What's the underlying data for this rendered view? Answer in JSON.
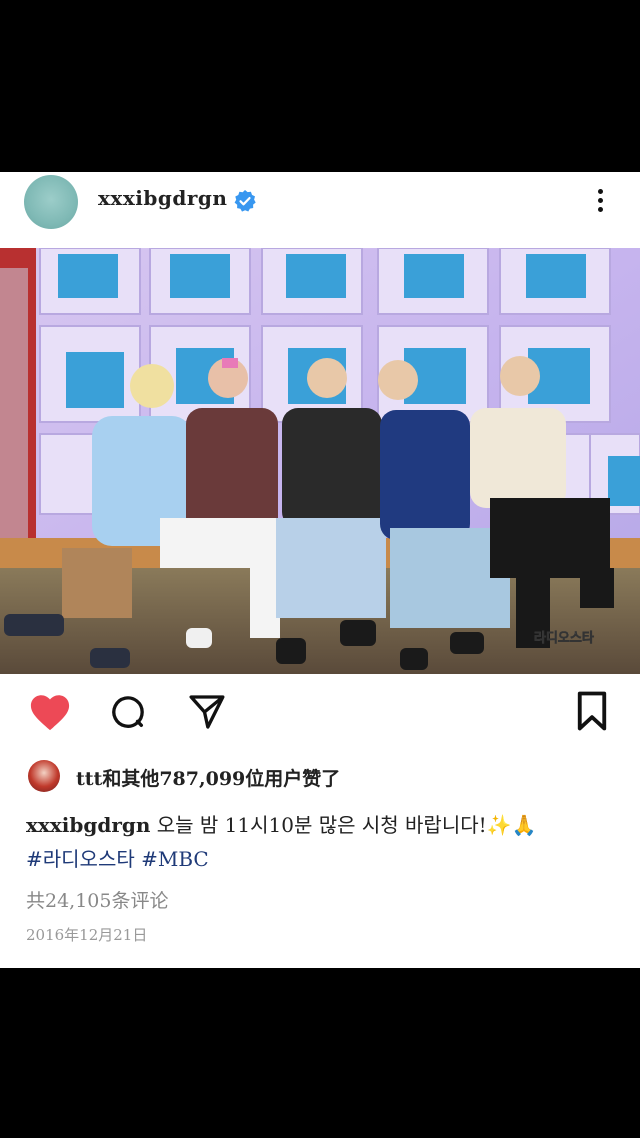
{
  "post": {
    "username": "xxxibgdrgn",
    "verified_icon": "verified-badge-icon",
    "more_icon": "more-vertical-icon",
    "likes_text": "ttt和其他787,099位用户赞了",
    "caption_username": "xxxibgdrgn",
    "caption_text": "오늘 밤 11시10분 많은 시청 바랍니다!✨🙏",
    "hashtag1": "#라디오스타",
    "hashtag2": "#MBC",
    "comments_text": "共24,105条评论",
    "date": "2016年12月21日",
    "watermark": "라디오스타"
  },
  "colors": {
    "like": "#ed4956",
    "verified": "#3897f0",
    "hashtag": "#1f3a78"
  }
}
